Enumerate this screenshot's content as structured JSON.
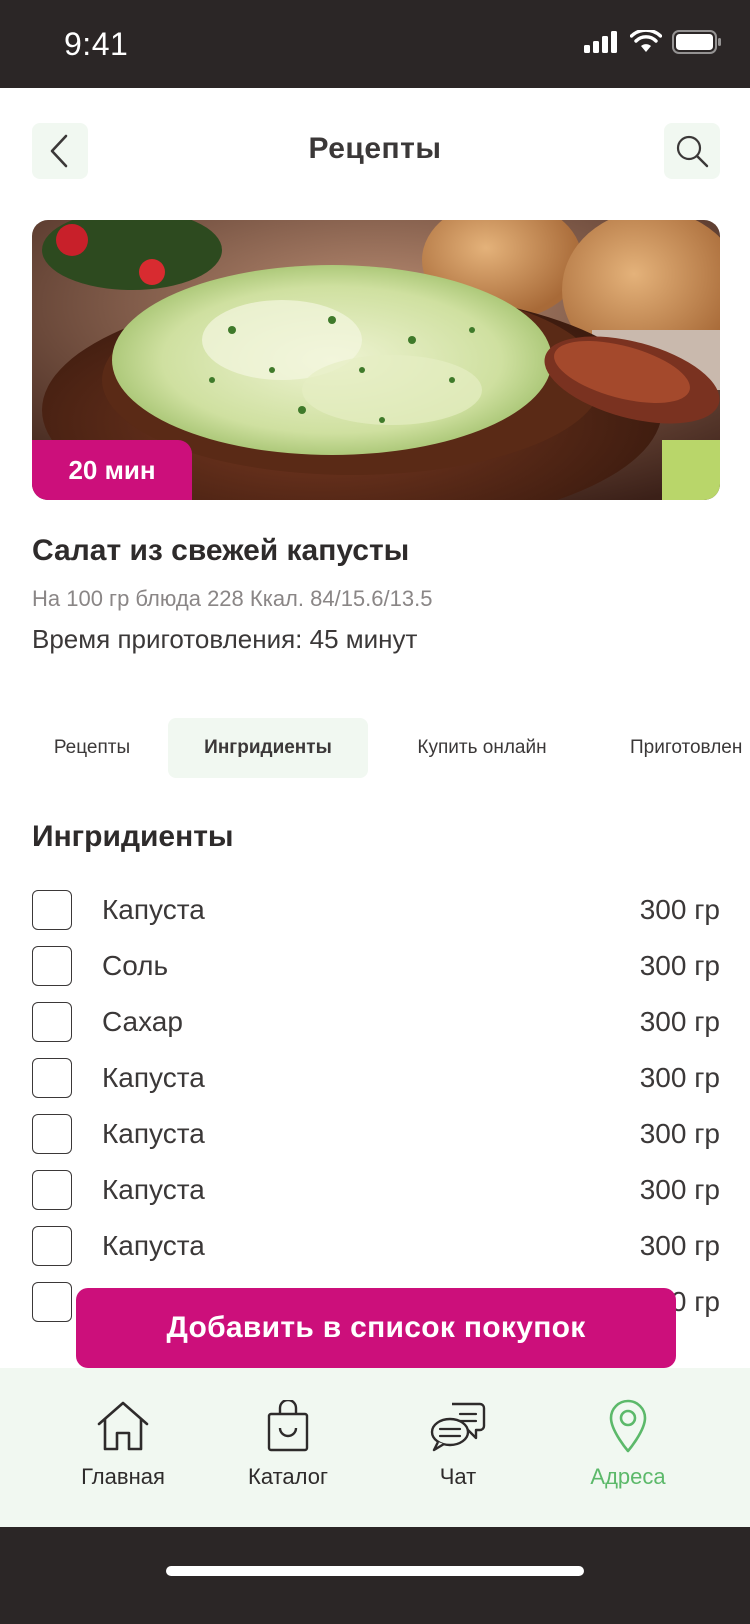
{
  "status_bar": {
    "time": "9:41"
  },
  "header": {
    "title": "Рецепты",
    "back_icon": "chevron-left-icon",
    "search_icon": "search-icon"
  },
  "recipe": {
    "time_badge": "20 мин",
    "title": "Салат из свежей капусты",
    "meta": "На 100 гр блюда 228 Ккал. 84/15.6/13.5",
    "cook_time": "Время приготовления: 45 минут"
  },
  "tabs": [
    {
      "label": "Рецепты",
      "active": false
    },
    {
      "label": "Ингридиенты",
      "active": true
    },
    {
      "label": "Купить онлайн",
      "active": false
    },
    {
      "label": "Приготовлен",
      "active": false
    }
  ],
  "ingredients": {
    "title": "Ингридиенты",
    "items": [
      {
        "name": "Капуста",
        "amount": "300 гр",
        "checked": false
      },
      {
        "name": "Соль",
        "amount": "300 гр",
        "checked": false
      },
      {
        "name": "Сахар",
        "amount": "300 гр",
        "checked": false
      },
      {
        "name": "Капуста",
        "amount": "300 гр",
        "checked": false
      },
      {
        "name": "Капуста",
        "amount": "300 гр",
        "checked": false
      },
      {
        "name": "Капуста",
        "amount": "300 гр",
        "checked": false
      },
      {
        "name": "Капуста",
        "amount": "300 гр",
        "checked": false
      },
      {
        "name": "",
        "amount": "0 гр",
        "checked": false
      }
    ]
  },
  "add_button": {
    "label": "Добавить в список покупок"
  },
  "tab_bar": {
    "items": [
      {
        "label": "Главная",
        "icon": "home-icon",
        "active": false
      },
      {
        "label": "Каталог",
        "icon": "shopping-bag-icon",
        "active": false
      },
      {
        "label": "Чат",
        "icon": "chat-icon",
        "active": false
      },
      {
        "label": "Адреса",
        "icon": "location-pin-icon",
        "active": true
      }
    ]
  },
  "colors": {
    "accent": "#cc0f7b",
    "active_green": "#5cb96a",
    "light_green_bg": "#f1f8f1",
    "dark_bar": "#2b2626",
    "text": "#3b3838"
  }
}
